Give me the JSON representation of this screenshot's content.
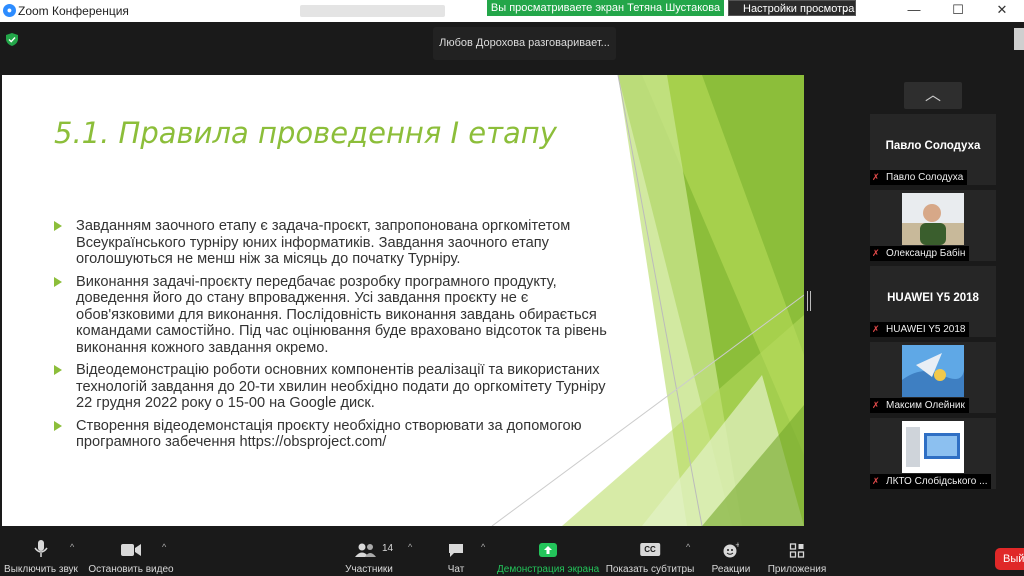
{
  "window": {
    "app_title": "Zoom Конференция",
    "share_banner": "Вы просматриваете экран Тетяна Шустакова",
    "view_options": "Настройки просмотра",
    "controls": {
      "minimize": "—",
      "maximize": "☐",
      "close": "✕"
    }
  },
  "meeting": {
    "active_speaker": "Любов Дорохова разговаривает..."
  },
  "slide": {
    "title": "5.1. Правила проведення І етапу",
    "bullets": [
      "Завданням заочного етапу є задача-проєкт, запропонована оргкомітетом Всеукраїнського турніру юних інформатиків. Завдання заочного етапу оголошуються не менш ніж за місяць до початку Турніру.",
      "Виконання задачі-проєкту передбачає розробку програмного продукту, доведення його до стану впровадження. Усі завдання проєкту не є обов'язковими для виконання. Послідовність виконання завдань обирається командами самостійно. Під час оцінювання буде враховано відсоток та рівень виконання кожного завдання окремо.",
      "Відеодемонстрацію роботи основних компонентів реалізації та використаних технологій завдання до 20-ти хвилин необхідно подати до оргкомітету Турніру 22 грудня 2022 року о 15-00 на Google диск.",
      "Створення відеодемонстація проєкту необхідно створювати за допомогою програмного забечення https://obsproject.com/"
    ],
    "accent_color": "#8cbe3a"
  },
  "participants": [
    {
      "name": "Павло Солодуха",
      "display": "Павло Солодуха",
      "video": false
    },
    {
      "name": "Олександр Бабін",
      "video": true
    },
    {
      "name": "HUAWEI Y5 2018",
      "display": "HUAWEI Y5 2018",
      "video": false
    },
    {
      "name": "Максим Олейник",
      "video": true
    },
    {
      "name": "ЛКТО Слобідського ...",
      "video": true
    }
  ],
  "toolbar": {
    "mute": "Выключить звук",
    "video": "Остановить видео",
    "participants": "Участники",
    "participants_count": "14",
    "chat": "Чат",
    "share": "Демонстрация экрана",
    "captions": "Показать субтитры",
    "cc": "CC",
    "reactions": "Реакции",
    "apps": "Приложения",
    "end": "Выйти"
  }
}
